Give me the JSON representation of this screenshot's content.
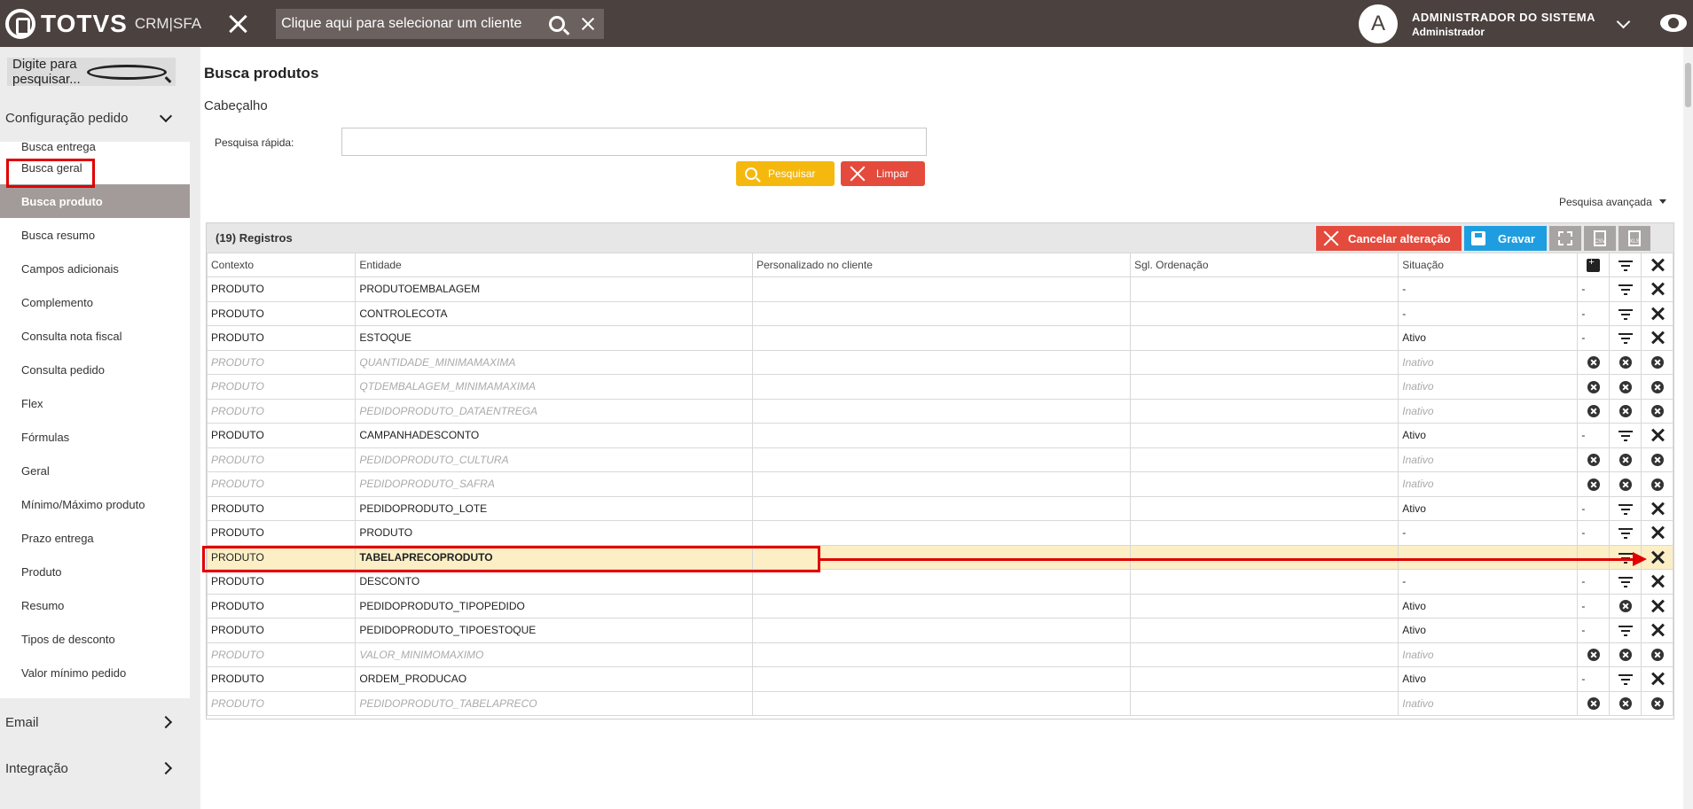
{
  "header": {
    "brand": "TOTVS",
    "product": "CRM|SFA",
    "client_search_placeholder": "Clique aqui para selecionar um cliente",
    "user_initial": "A",
    "user_name": "ADMINISTRADOR DO SISTEMA",
    "user_role": "Administrador"
  },
  "sidebar": {
    "search_placeholder": "Digite para pesquisar...",
    "section_config": "Configuração pedido",
    "items": [
      "Busca entrega",
      "Busca geral",
      "Busca produto",
      "Busca resumo",
      "Campos adicionais",
      "Complemento",
      "Consulta nota fiscal",
      "Consulta pedido",
      "Flex",
      "Fórmulas",
      "Geral",
      "Mínimo/Máximo produto",
      "Prazo entrega",
      "Produto",
      "Resumo",
      "Tipos de desconto",
      "Valor mínimo pedido"
    ],
    "section_email": "Email",
    "section_integration": "Integração"
  },
  "main": {
    "page_title": "Busca produtos",
    "section_title": "Cabeçalho",
    "quick_search_label": "Pesquisa rápida:",
    "btn_search": "Pesquisar",
    "btn_clear": "Limpar",
    "advanced_search": "Pesquisa avançada"
  },
  "grid": {
    "count": "(19) Registros",
    "btn_cancel": "Cancelar alteração",
    "btn_save": "Gravar",
    "csv": "CSV",
    "xls": "XLS",
    "columns": [
      "Contexto",
      "Entidade",
      "Personalizado no cliente",
      "Sgl. Ordenação",
      "Situação"
    ],
    "rows": [
      {
        "ctx": "PRODUTO",
        "ent": "PRODUTOEMBALAGEM",
        "sit": "-",
        "c1": "-",
        "inactive": false
      },
      {
        "ctx": "PRODUTO",
        "ent": "CONTROLECOTA",
        "sit": "-",
        "c1": "-",
        "inactive": false
      },
      {
        "ctx": "PRODUTO",
        "ent": "ESTOQUE",
        "sit": "Ativo",
        "c1": "-",
        "inactive": false
      },
      {
        "ctx": "PRODUTO",
        "ent": "QUANTIDADE_MINIMAMAXIMA",
        "sit": "Inativo",
        "c1": "",
        "inactive": true
      },
      {
        "ctx": "PRODUTO",
        "ent": "QTDEMBALAGEM_MINIMAMAXIMA",
        "sit": "Inativo",
        "c1": "",
        "inactive": true
      },
      {
        "ctx": "PRODUTO",
        "ent": "PEDIDOPRODUTO_DATAENTREGA",
        "sit": "Inativo",
        "c1": "",
        "inactive": true
      },
      {
        "ctx": "PRODUTO",
        "ent": "CAMPANHADESCONTO",
        "sit": "Ativo",
        "c1": "-",
        "inactive": false
      },
      {
        "ctx": "PRODUTO",
        "ent": "PEDIDOPRODUTO_CULTURA",
        "sit": "Inativo",
        "c1": "",
        "inactive": true
      },
      {
        "ctx": "PRODUTO",
        "ent": "PEDIDOPRODUTO_SAFRA",
        "sit": "Inativo",
        "c1": "",
        "inactive": true
      },
      {
        "ctx": "PRODUTO",
        "ent": "PEDIDOPRODUTO_LOTE",
        "sit": "Ativo",
        "c1": "-",
        "inactive": false
      },
      {
        "ctx": "PRODUTO",
        "ent": "PRODUTO",
        "sit": "-",
        "c1": "-",
        "inactive": false
      },
      {
        "ctx": "PRODUTO",
        "ent": "TABELAPRECOPRODUTO",
        "sit": "",
        "c1": "",
        "inactive": false,
        "selected": true
      },
      {
        "ctx": "PRODUTO",
        "ent": "DESCONTO",
        "sit": "-",
        "c1": "-",
        "inactive": false
      },
      {
        "ctx": "PRODUTO",
        "ent": "PEDIDOPRODUTO_TIPOPEDIDO",
        "sit": "Ativo",
        "c1": "-",
        "inactive": false,
        "xmid": true
      },
      {
        "ctx": "PRODUTO",
        "ent": "PEDIDOPRODUTO_TIPOESTOQUE",
        "sit": "Ativo",
        "c1": "-",
        "inactive": false
      },
      {
        "ctx": "PRODUTO",
        "ent": "VALOR_MINIMOMAXIMO",
        "sit": "Inativo",
        "c1": "",
        "inactive": true
      },
      {
        "ctx": "PRODUTO",
        "ent": "ORDEM_PRODUCAO",
        "sit": "Ativo",
        "c1": "-",
        "inactive": false
      },
      {
        "ctx": "PRODUTO",
        "ent": "PEDIDOPRODUTO_TABELAPRECO",
        "sit": "Inativo",
        "c1": "",
        "inactive": true
      }
    ]
  },
  "colors": {
    "topbar": "#4b413f",
    "active_menu": "#a39b99",
    "search_btn": "#f5b80e",
    "clear_btn": "#e44b3d",
    "save_btn": "#1e9ee0",
    "selected_row": "#fcefc6",
    "annotation": "#e00000"
  }
}
